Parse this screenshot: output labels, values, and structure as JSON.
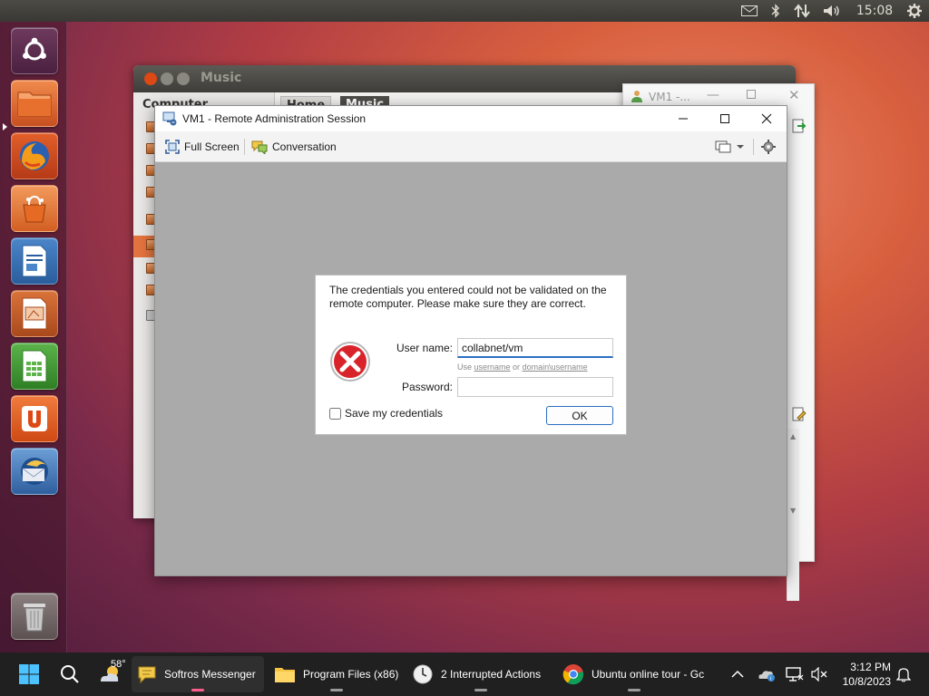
{
  "top_panel": {
    "clock": "15:08",
    "indicators": [
      "mail-icon",
      "bluetooth-icon",
      "network-icon",
      "volume-icon",
      "gear-icon"
    ]
  },
  "launcher": {
    "items": [
      "dash-home",
      "files",
      "firefox",
      "software-center",
      "writer",
      "impress",
      "calc",
      "ubuntu-one",
      "thunderbird",
      "trash"
    ]
  },
  "music_window": {
    "title": "Music",
    "sidebar_heading": "Computer",
    "breadcrumbs": [
      "Home",
      "Music"
    ]
  },
  "vm1_bg_window": {
    "title": "VM1 -..."
  },
  "rdp_window": {
    "title": "VM1 - Remote Administration Session",
    "toolbar": {
      "fullscreen_label": "Full Screen",
      "conversation_label": "Conversation"
    }
  },
  "dialog": {
    "message": "The credentials you entered could not be validated on the remote computer. Please make sure they are correct.",
    "username_label": "User name:",
    "username_value": "collabnet/vm",
    "hint_prefix": "Use ",
    "hint_link1": "username",
    "hint_mid": " or ",
    "hint_link2": "domain\\username",
    "password_label": "Password:",
    "password_value": "",
    "save_label": "Save my credentials",
    "save_checked": false,
    "ok_label": "OK"
  },
  "taskbar": {
    "weather_temp": "58°",
    "apps": [
      {
        "label": "Softros Messenger"
      },
      {
        "label": "Program Files (x86)"
      },
      {
        "label": "2 Interrupted Actions"
      },
      {
        "label": "Ubuntu online tour - Gc"
      }
    ],
    "time": "3:12 PM",
    "date": "10/8/2023"
  },
  "colors": {
    "ubuntu_orange": "#dd4814",
    "dialog_accent": "#2a6fc2",
    "error_red": "#d9232b"
  }
}
